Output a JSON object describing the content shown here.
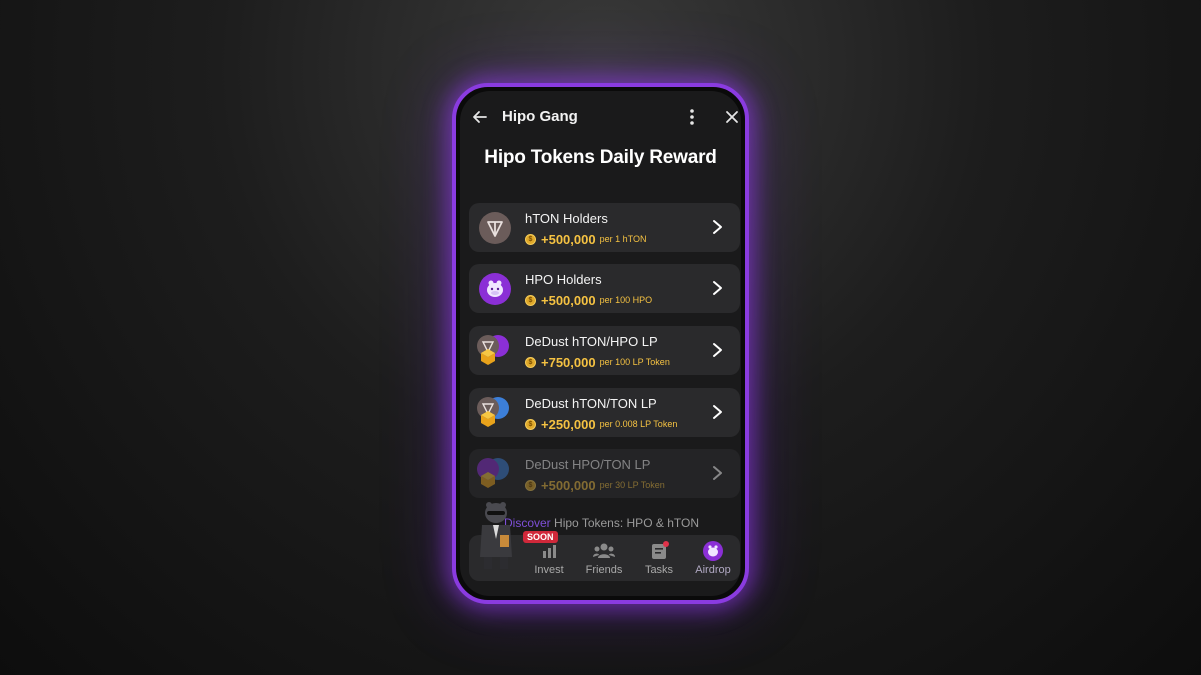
{
  "header": {
    "app_title": "Hipo Gang",
    "back_icon": "arrow-left-icon",
    "menu_icon": "kebab-menu-icon",
    "close_icon": "close-icon"
  },
  "page_title": "Hipo Tokens Daily Reward",
  "rewards": [
    {
      "name": "hTON Holders",
      "amount": "+500,000",
      "per": "per 1 hTON",
      "icon": "hton-logo-icon"
    },
    {
      "name": "HPO Holders",
      "amount": "+500,000",
      "per": "per 100 HPO",
      "icon": "hpo-logo-icon"
    },
    {
      "name": "DeDust hTON/HPO LP",
      "amount": "+750,000",
      "per": "per 100 LP Token",
      "icon": "lp-pair-icon"
    },
    {
      "name": "DeDust hTON/TON LP",
      "amount": "+250,000",
      "per": "per 0.008 LP Token",
      "icon": "lp-pair-icon"
    },
    {
      "name": "DeDust HPO/TON LP",
      "amount": "+500,000",
      "per": "per 30 LP Token",
      "icon": "lp-pair-icon"
    }
  ],
  "promo": {
    "accent": "Discover",
    "text": "Hipo Tokens: HPO & hTON"
  },
  "nav": {
    "soon_badge": "SOON",
    "items": [
      {
        "label": "Invest",
        "icon": "chart-bars-icon"
      },
      {
        "label": "Friends",
        "icon": "people-icon"
      },
      {
        "label": "Tasks",
        "icon": "tasks-icon"
      },
      {
        "label": "Airdrop",
        "icon": "hippo-icon"
      }
    ]
  },
  "colors": {
    "accent": "#8a3be0",
    "gold": "#f5c242",
    "card": "#2a2a2c"
  }
}
